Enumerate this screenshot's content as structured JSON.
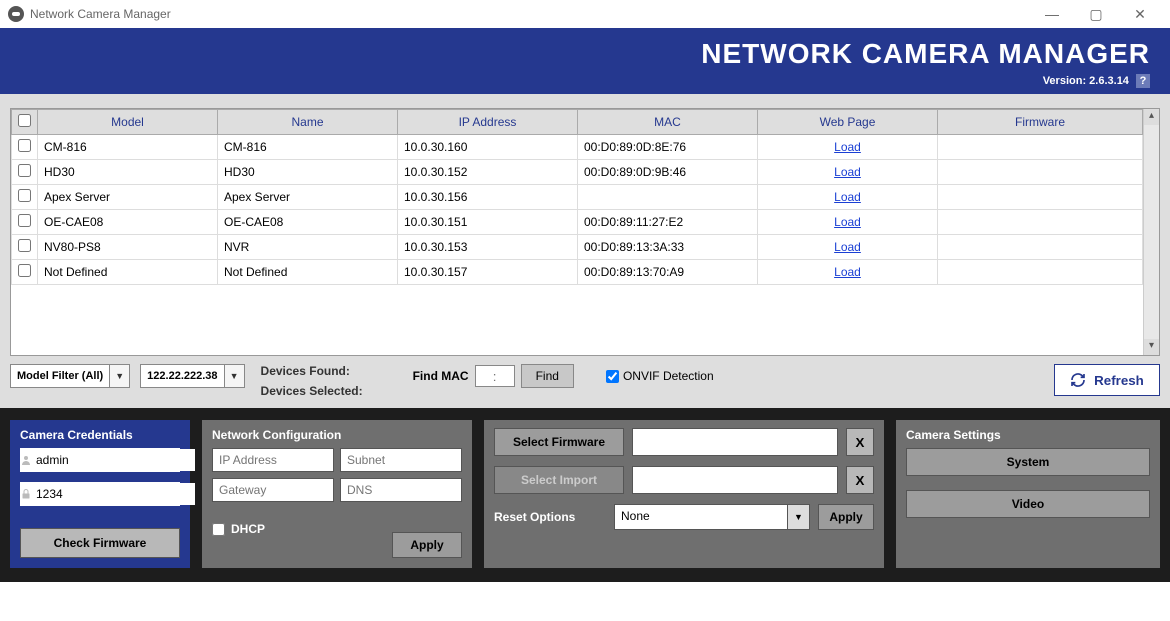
{
  "window": {
    "title": "Network Camera Manager"
  },
  "header": {
    "title": "NETWORK CAMERA MANAGER",
    "version_label": "Version:",
    "version": "2.6.3.14",
    "help": "?"
  },
  "table": {
    "headers": {
      "model": "Model",
      "name": "Name",
      "ip": "IP Address",
      "mac": "MAC",
      "web": "Web Page",
      "firmware": "Firmware"
    },
    "web_link_label": "Load",
    "rows": [
      {
        "model": "CM-816",
        "name": "CM-816",
        "ip": "10.0.30.160",
        "mac": "00:D0:89:0D:8E:76",
        "firmware": "",
        "has_web": true
      },
      {
        "model": "HD30",
        "name": "HD30",
        "ip": "10.0.30.152",
        "mac": "00:D0:89:0D:9B:46",
        "firmware": "",
        "has_web": true
      },
      {
        "model": "Apex Server",
        "name": "Apex Server",
        "ip": "10.0.30.156",
        "mac": "",
        "firmware": "",
        "has_web": true
      },
      {
        "model": "OE-CAE08",
        "name": "OE-CAE08",
        "ip": "10.0.30.151",
        "mac": "00:D0:89:11:27:E2",
        "firmware": "",
        "has_web": true
      },
      {
        "model": "NV80-PS8",
        "name": "NVR",
        "ip": "10.0.30.153",
        "mac": "00:D0:89:13:3A:33",
        "firmware": "",
        "has_web": true
      },
      {
        "model": "Not Defined",
        "name": "Not Defined",
        "ip": "10.0.30.157",
        "mac": "00:D0:89:13:70:A9",
        "firmware": "",
        "has_web": true
      }
    ]
  },
  "filters": {
    "model_filter": "Model Filter (All)",
    "ip_filter": "122.22.222.38",
    "devices_found_label": "Devices Found:",
    "devices_selected_label": "Devices Selected:",
    "find_mac_label": "Find MAC",
    "mac_sep": ":",
    "find_button": "Find",
    "onvif_label": "ONVIF Detection",
    "onvif_checked": true,
    "refresh": "Refresh"
  },
  "credentials": {
    "title": "Camera Credentials",
    "username": "admin",
    "password": "1234",
    "check_firmware": "Check Firmware"
  },
  "network": {
    "title": "Network Configuration",
    "ip_placeholder": "IP Address",
    "subnet_placeholder": "Subnet",
    "gateway_placeholder": "Gateway",
    "dns_placeholder": "DNS",
    "dhcp_label": "DHCP",
    "apply": "Apply"
  },
  "firmware": {
    "select_firmware": "Select Firmware",
    "select_import": "Select Import",
    "clear": "X",
    "reset_options_label": "Reset Options",
    "reset_value": "None",
    "apply": "Apply"
  },
  "settings": {
    "title": "Camera Settings",
    "system": "System",
    "video": "Video"
  }
}
